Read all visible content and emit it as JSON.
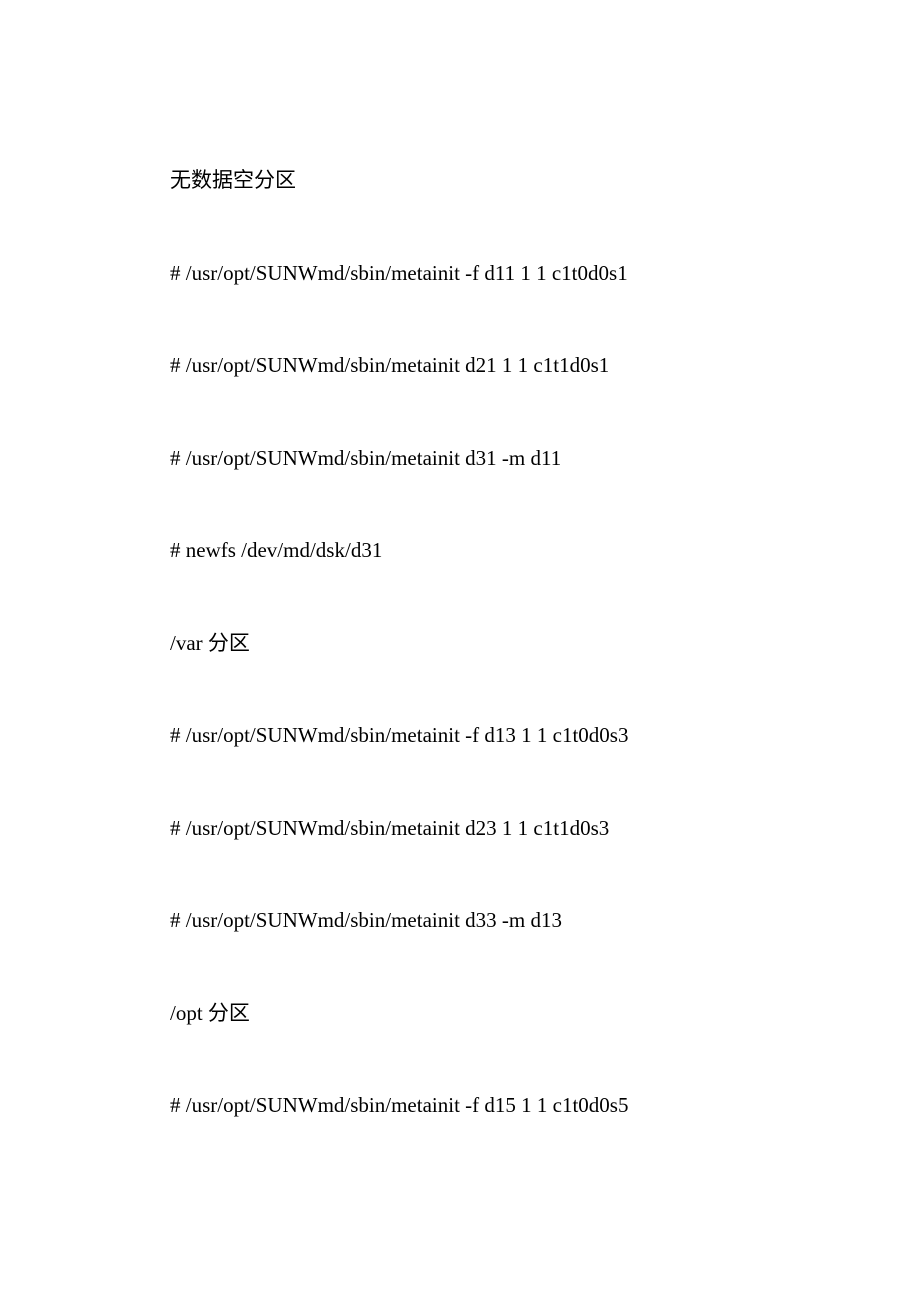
{
  "lines": [
    "无数据空分区",
    "# /usr/opt/SUNWmd/sbin/metainit -f d11 1 1 c1t0d0s1",
    "# /usr/opt/SUNWmd/sbin/metainit d21 1 1 c1t1d0s1",
    "# /usr/opt/SUNWmd/sbin/metainit d31 -m d11",
    "# newfs /dev/md/dsk/d31",
    "/var 分区",
    "# /usr/opt/SUNWmd/sbin/metainit -f d13 1 1 c1t0d0s3",
    "# /usr/opt/SUNWmd/sbin/metainit d23 1 1 c1t1d0s3",
    "# /usr/opt/SUNWmd/sbin/metainit d33 -m d13",
    "/opt 分区",
    "# /usr/opt/SUNWmd/sbin/metainit -f d15 1 1 c1t0d0s5"
  ]
}
